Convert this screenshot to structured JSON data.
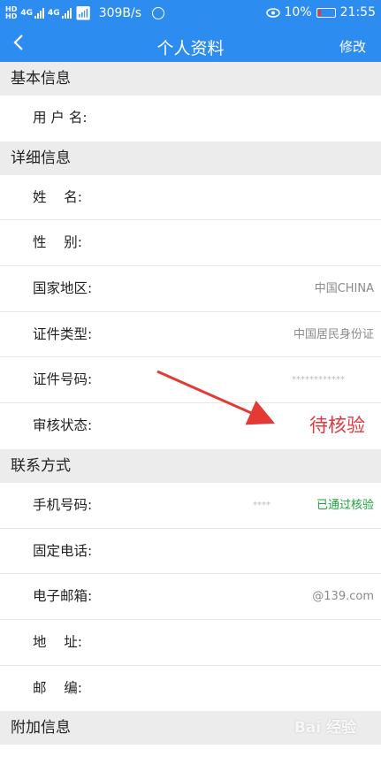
{
  "status_bar": {
    "network_speed": "309B/s",
    "battery": "10%",
    "time": "21:55",
    "hd_label": "HD",
    "net_type": "4G"
  },
  "nav": {
    "back_icon": "chevron-left-icon",
    "title": "个人资料",
    "edit_label": "修改",
    "color": "#2d8cf0"
  },
  "sections": {
    "basic": {
      "title": "基本信息",
      "username_label": "用 户 名:"
    },
    "detail": {
      "title": "详细信息",
      "name_label": "姓    名:",
      "gender_label": "性    别:",
      "country_label": "国家地区:",
      "country_value": "中国CHINA",
      "id_type_label": "证件类型:",
      "id_type_value": "中国居民身份证",
      "id_number_label": "证件号码:",
      "id_number_value": "************",
      "review_label": "审核状态:",
      "review_value": "待核验"
    },
    "contact": {
      "title": "联系方式",
      "mobile_label": "手机号码:",
      "mobile_value": "****",
      "mobile_status": "已通过核验",
      "phone_label": "固定电话:",
      "email_label": "电子邮箱:",
      "email_value": "@139.com",
      "address_label": "地    址:",
      "zip_label": "邮    编:"
    },
    "extra": {
      "title": "附加信息"
    }
  },
  "watermark": "Bai 经验",
  "colors": {
    "pending": "#e0383e",
    "verified": "#1aa33a",
    "arrow": "#e53935"
  }
}
